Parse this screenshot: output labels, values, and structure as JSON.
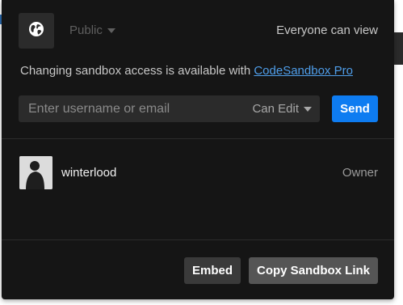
{
  "header": {
    "globe_icon": "globe-icon",
    "privacy_label": "Public",
    "visibility_text": "Everyone can view"
  },
  "notice": {
    "text": "Changing sandbox access is available with",
    "link_text": "CodeSandbox Pro"
  },
  "invite": {
    "placeholder": "Enter username or email",
    "value": "",
    "permission_label": "Can Edit",
    "send_label": "Send"
  },
  "members": [
    {
      "name": "winterlood",
      "role": "Owner",
      "avatar": "user-avatar"
    }
  ],
  "footer": {
    "embed_label": "Embed",
    "copy_label": "Copy Sandbox Link"
  },
  "colors": {
    "panel_bg": "#151515",
    "input_bg": "#2b2b2b",
    "accent_blue": "#0e7cf1",
    "link_blue": "#4f9eea",
    "secondary_button": "#555555"
  }
}
